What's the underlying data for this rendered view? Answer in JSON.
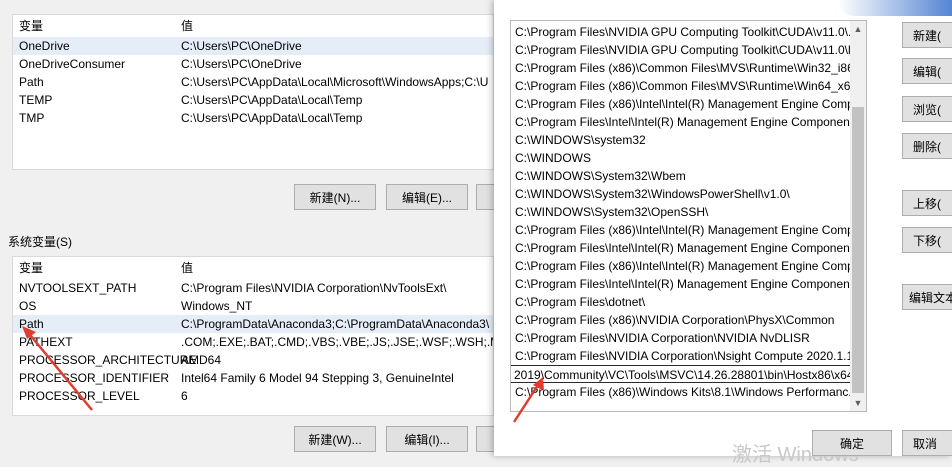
{
  "user_vars": {
    "header": {
      "name": "变量",
      "value": "值"
    },
    "rows": [
      {
        "name": "OneDrive",
        "value": "C:\\Users\\PC\\OneDrive"
      },
      {
        "name": "OneDriveConsumer",
        "value": "C:\\Users\\PC\\OneDrive"
      },
      {
        "name": "Path",
        "value": "C:\\Users\\PC\\AppData\\Local\\Microsoft\\WindowsApps;C:\\U"
      },
      {
        "name": "TEMP",
        "value": "C:\\Users\\PC\\AppData\\Local\\Temp"
      },
      {
        "name": "TMP",
        "value": "C:\\Users\\PC\\AppData\\Local\\Temp"
      }
    ],
    "new_button": "新建(N)...",
    "edit_button": "编辑(E)..."
  },
  "system_vars": {
    "section_title": "系统变量(S)",
    "header": {
      "name": "变量",
      "value": "值"
    },
    "rows": [
      {
        "name": "NVTOOLSEXT_PATH",
        "value": "C:\\Program Files\\NVIDIA Corporation\\NvToolsExt\\"
      },
      {
        "name": "OS",
        "value": "Windows_NT"
      },
      {
        "name": "Path",
        "value": "C:\\ProgramData\\Anaconda3;C:\\ProgramData\\Anaconda3\\"
      },
      {
        "name": "PATHEXT",
        "value": ".COM;.EXE;.BAT;.CMD;.VBS;.VBE;.JS;.JSE;.WSF;.WSH;.MSC"
      },
      {
        "name": "PROCESSOR_ARCHITECTURE",
        "value": "AMD64"
      },
      {
        "name": "PROCESSOR_IDENTIFIER",
        "value": "Intel64 Family 6 Model 94 Stepping 3, GenuineIntel"
      },
      {
        "name": "PROCESSOR_LEVEL",
        "value": "6"
      }
    ],
    "new_button": "新建(W)...",
    "edit_button": "编辑(I)..."
  },
  "edit_dialog": {
    "entries": [
      "C:\\Program Files\\NVIDIA GPU Computing Toolkit\\CUDA\\v11.0\\...",
      "C:\\Program Files\\NVIDIA GPU Computing Toolkit\\CUDA\\v11.0\\l...",
      "C:\\Program Files (x86)\\Common Files\\MVS\\Runtime\\Win32_i86",
      "C:\\Program Files (x86)\\Common Files\\MVS\\Runtime\\Win64_x64",
      "C:\\Program Files (x86)\\Intel\\Intel(R) Management Engine Comp...",
      "C:\\Program Files\\Intel\\Intel(R) Management Engine Componen...",
      "C:\\WINDOWS\\system32",
      "C:\\WINDOWS",
      "C:\\WINDOWS\\System32\\Wbem",
      "C:\\WINDOWS\\System32\\WindowsPowerShell\\v1.0\\",
      "C:\\WINDOWS\\System32\\OpenSSH\\",
      "C:\\Program Files (x86)\\Intel\\Intel(R) Management Engine Comp...",
      "C:\\Program Files\\Intel\\Intel(R) Management Engine Componen...",
      "C:\\Program Files (x86)\\Intel\\Intel(R) Management Engine Comp...",
      "C:\\Program Files\\Intel\\Intel(R) Management Engine Componen...",
      "C:\\Program Files\\dotnet\\",
      "C:\\Program Files (x86)\\NVIDIA Corporation\\PhysX\\Common",
      "C:\\Program Files\\NVIDIA Corporation\\NVIDIA NvDLISR",
      "C:\\Program Files\\NVIDIA Corporation\\Nsight Compute 2020.1.1\\",
      "2019\\Community\\VC\\Tools\\MSVC\\14.26.28801\\bin\\Hostx86\\x64",
      "C:\\Program Files (x86)\\Windows Kits\\8.1\\Windows Performanc..."
    ],
    "buttons": {
      "new": "新建(",
      "edit": "编辑(",
      "browse": "浏览(",
      "delete": "删除(",
      "move_up": "上移(",
      "move_down": "下移(",
      "edit_text": "编辑文本"
    },
    "ok_button": "确定",
    "cancel_button": "取消",
    "activate_watermark": "激活 Windows"
  }
}
